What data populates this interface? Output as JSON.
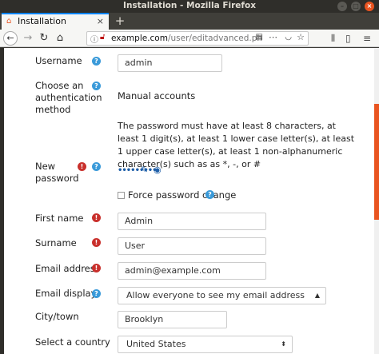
{
  "window": {
    "title": "Installation - Mozilla Firefox",
    "buttons": {
      "minimize": "–",
      "maximize": "□",
      "close": "×"
    }
  },
  "tab": {
    "title": "Installation",
    "close": "×",
    "new_tab": "+"
  },
  "nav": {
    "url_host": "example.com",
    "url_path": "/user/editadvanced.ph",
    "icons": [
      "back-icon",
      "forward-icon",
      "reload-icon",
      "home-icon",
      "reader-view-icon",
      "page-actions-icon",
      "pocket-icon",
      "bookmark-star-icon",
      "library-icon",
      "sidebar-icon",
      "menu-icon"
    ]
  },
  "form": {
    "username": {
      "label": "Username",
      "value": "admin"
    },
    "auth": {
      "label_lines": [
        "Choose an",
        "authentication",
        "method"
      ],
      "value": "Manual accounts"
    },
    "password_policy": "The password must have at least 8 characters, at least 1 digit(s), at least 1 lower case letter(s), at least 1 upper case letter(s), at least 1 non-alphanumeric character(s) such as as *, -, or #",
    "new_password": {
      "label_lines": [
        "New",
        "password"
      ],
      "masked": "•••••••••"
    },
    "force_change": {
      "label": "Force password change",
      "checked": false
    },
    "first_name": {
      "label": "First name",
      "value": "Admin"
    },
    "surname": {
      "label": "Surname",
      "value": "User"
    },
    "email": {
      "label": "Email address",
      "value": "admin@example.com"
    },
    "email_display": {
      "label": "Email display",
      "selected": "Allow everyone to see my email address"
    },
    "city": {
      "label": "City/town",
      "value": "Brooklyn"
    },
    "country": {
      "label": "Select a country",
      "selected": "United States"
    }
  },
  "colors": {
    "accent": "#e95420",
    "help": "#3a9ad9",
    "required": "#c9302c",
    "link": "#1f5fa8"
  }
}
